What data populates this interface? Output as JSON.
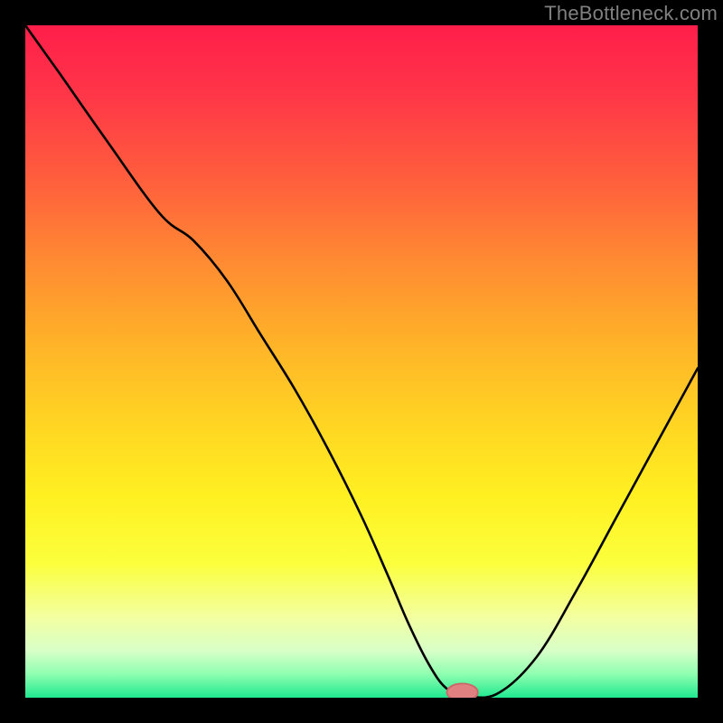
{
  "watermark": "TheBottleneck.com",
  "colors": {
    "frame": "#000000",
    "watermark": "#808080",
    "curve": "#000000",
    "marker_fill": "#e08080",
    "marker_stroke": "#c86868",
    "gradient_stops": [
      {
        "offset": 0.0,
        "color": "#ff1e4a"
      },
      {
        "offset": 0.1,
        "color": "#ff3548"
      },
      {
        "offset": 0.22,
        "color": "#ff5b3e"
      },
      {
        "offset": 0.35,
        "color": "#ff8a32"
      },
      {
        "offset": 0.48,
        "color": "#ffb528"
      },
      {
        "offset": 0.6,
        "color": "#ffd722"
      },
      {
        "offset": 0.7,
        "color": "#fff022"
      },
      {
        "offset": 0.8,
        "color": "#fbff3c"
      },
      {
        "offset": 0.88,
        "color": "#f3ffa0"
      },
      {
        "offset": 0.93,
        "color": "#d8ffc8"
      },
      {
        "offset": 0.965,
        "color": "#8effb0"
      },
      {
        "offset": 1.0,
        "color": "#20e890"
      }
    ]
  },
  "chart_data": {
    "type": "line",
    "title": "",
    "xlabel": "",
    "ylabel": "",
    "xlim": [
      0,
      100
    ],
    "ylim": [
      0,
      100
    ],
    "x": [
      0,
      5,
      12,
      20,
      25,
      30,
      35,
      40,
      45,
      50,
      54,
      57,
      60,
      62.5,
      65,
      70,
      76,
      82,
      88,
      94,
      100
    ],
    "values": [
      100,
      93,
      83,
      72,
      68,
      62,
      54,
      46,
      37,
      27,
      18,
      11,
      5,
      1.5,
      0.5,
      0.5,
      6,
      16,
      27,
      38,
      49
    ],
    "marker": {
      "x": 65,
      "y": 0.8,
      "rx": 2.3,
      "ry": 1.3
    },
    "notes": "V-shaped bottleneck curve with minimum near x≈65; values are percentage-scale estimates read from the unlabeled plot."
  }
}
